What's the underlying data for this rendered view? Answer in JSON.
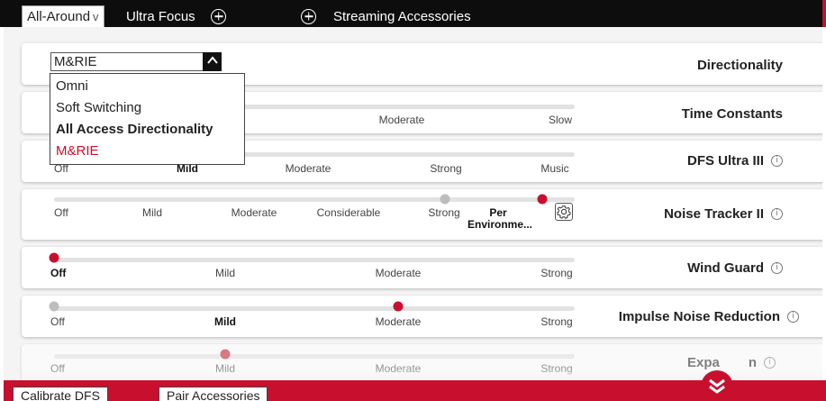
{
  "tabs": {
    "active_label": "All-Around",
    "active_chevron": "v",
    "ultra_label": "Ultra Focus",
    "add_icon": "plus-circle-icon",
    "streaming_label": "Streaming Accessories"
  },
  "colors": {
    "accent": "#c8102e",
    "topbar": "#0d0d0d",
    "track": "#e2e2e2",
    "inactive_dot": "#bdbdbd"
  },
  "directionality": {
    "title": "Directionality",
    "selected": "M&RIE",
    "options": [
      "Omni",
      "Soft Switching",
      "All Access Directionality",
      "M&RIE"
    ]
  },
  "time_constants": {
    "title": "Time Constants",
    "labels": [
      "Moderate",
      "Slow"
    ]
  },
  "dfs": {
    "title": "DFS Ultra III",
    "labels": [
      "Off",
      "Mild",
      "Moderate",
      "Strong",
      "Music"
    ]
  },
  "noise_tracker": {
    "title": "Noise Tracker II",
    "labels": [
      "Off",
      "Mild",
      "Moderate",
      "Considerable",
      "Strong"
    ],
    "selected_label_line1": "Per",
    "selected_label_line2": "Environme...",
    "gear_icon": "gear-icon"
  },
  "wind_guard": {
    "title": "Wind Guard",
    "labels": [
      "Off",
      "Mild",
      "Moderate",
      "Strong"
    ]
  },
  "impulse": {
    "title": "Impulse Noise Reduction",
    "labels": [
      "Off",
      "Mild",
      "Moderate",
      "Strong"
    ]
  },
  "expansion": {
    "title_start": "Expa",
    "title_end": "n",
    "labels": [
      "Off",
      "Mild",
      "Moderate",
      "Strong"
    ]
  },
  "info_icon": "i",
  "bottom": {
    "calibrate_label": "Calibrate DFS",
    "pair_label": "Pair Accessories"
  }
}
